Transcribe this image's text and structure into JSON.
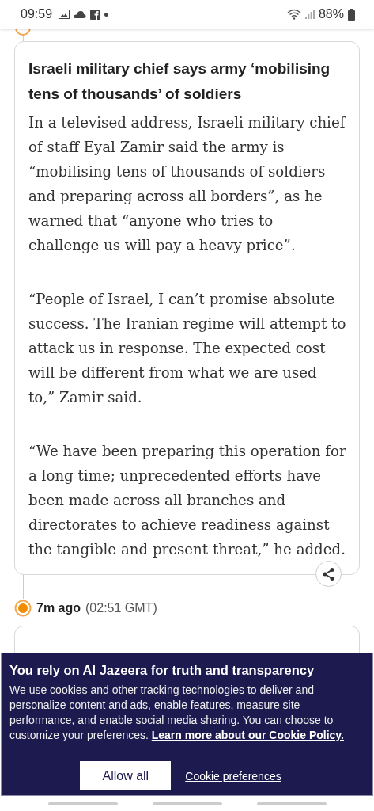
{
  "status_bar": {
    "time": "09:59",
    "battery": "88%"
  },
  "post": {
    "headline": "Israeli military chief says army ‘mobilising tens of thousands’ of soldiers",
    "paragraphs": [
      "In a televised address, Israeli military chief of staff Eyal Zamir said the army is “mobilising tens of thousands of soldiers and preparing across all borders”, as he warned that “anyone who tries to challenge us will pay a heavy price”.",
      "“People of Israel, I can’t promise absolute success. The Iranian regime will attempt to attack us in response. The expected cost will be different from what we are used to,” Zamir said.",
      "“We have been preparing this operation for a long time; unprecedented efforts have been made across all branches and directorates to achieve readiness against the tangible and present threat,” he added."
    ]
  },
  "next_post": {
    "age": "7m ago",
    "time": "(02:51 GMT)"
  },
  "cookie_banner": {
    "title": "You rely on Al Jazeera for truth and transparency",
    "text": "We use cookies and other tracking technologies to deliver and personalize content and ads, enable features, measure site performance, and enable social media sharing. You can choose to customize your preferences.",
    "link": "Learn more about our Cookie Policy.",
    "buttons": [
      "Allow all",
      "Cookie preferences"
    ]
  }
}
